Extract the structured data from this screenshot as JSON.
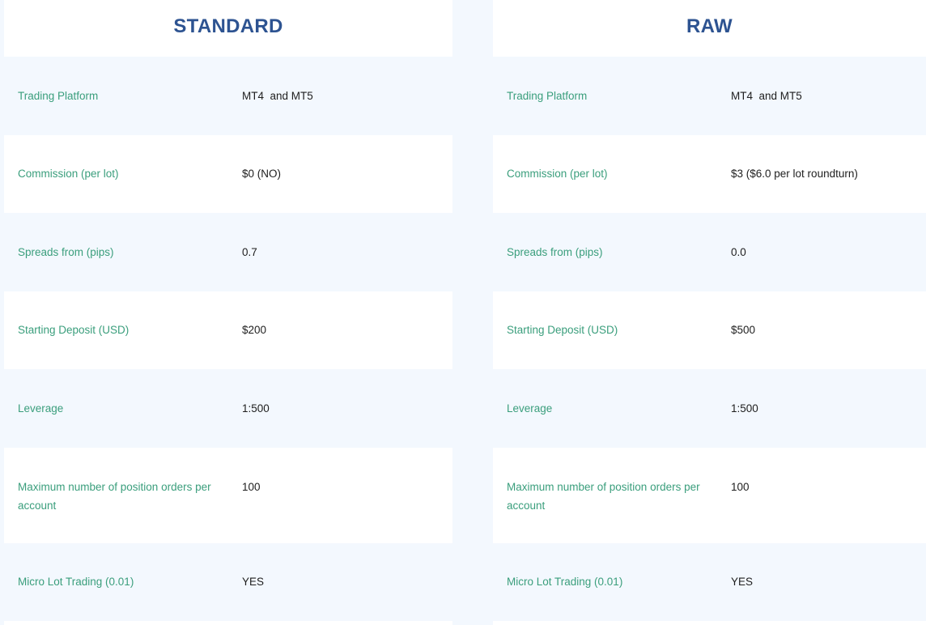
{
  "plans": [
    {
      "title": "STANDARD",
      "rows": [
        {
          "label": "Trading Platform",
          "value": "MT4  and MT5"
        },
        {
          "label": "Commission (per lot)",
          "value": "$0 (NO)"
        },
        {
          "label": "Spreads from (pips)",
          "value": "0.7"
        },
        {
          "label": "Starting Deposit (USD)",
          "value": "$200"
        },
        {
          "label": "Leverage",
          "value": "1:500"
        },
        {
          "label": "Maximum number of position orders per account",
          "value": "100"
        },
        {
          "label": "Micro Lot Trading (0.01)",
          "value": "YES"
        }
      ]
    },
    {
      "title": "RAW",
      "rows": [
        {
          "label": "Trading Platform",
          "value": "MT4  and MT5"
        },
        {
          "label": "Commission (per lot)",
          "value": "$3 ($6.0 per lot roundturn)"
        },
        {
          "label": "Spreads from (pips)",
          "value": "0.0"
        },
        {
          "label": "Starting Deposit (USD)",
          "value": "$500"
        },
        {
          "label": "Leverage",
          "value": "1:500"
        },
        {
          "label": "Maximum number of position orders per account",
          "value": "100"
        },
        {
          "label": "Micro Lot Trading (0.01)",
          "value": "YES"
        }
      ]
    }
  ]
}
